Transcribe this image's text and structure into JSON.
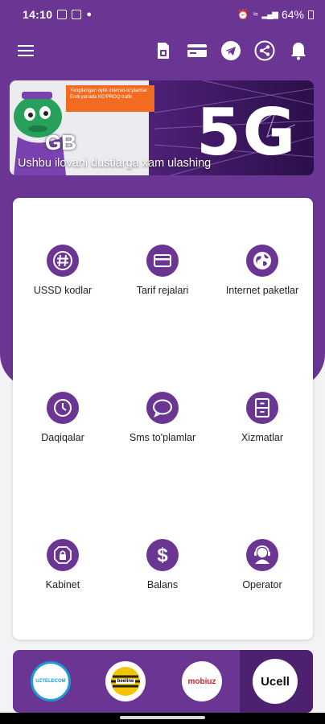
{
  "status_bar": {
    "time": "14:10",
    "battery": "64%"
  },
  "toolbar": {
    "icons": [
      "menu-icon",
      "sim-card-icon",
      "payment-card-icon",
      "telegram-icon",
      "share-icon",
      "bell-icon"
    ]
  },
  "banner": {
    "caption": "Ushbu ilovani dustlarga xam ulashing",
    "promo_text": "Yangilangan oylik internet-to'plamlar Endi yanada KO'PROQ trafik",
    "mascot_text": "GB",
    "big_text": "5G"
  },
  "menu": {
    "items": [
      {
        "label": "USSD kodlar",
        "icon": "hash-icon"
      },
      {
        "label": "Tarif rejalari",
        "icon": "card-icon"
      },
      {
        "label": "Internet paketlar",
        "icon": "globe-icon"
      },
      {
        "label": "Daqiqalar",
        "icon": "clock-icon"
      },
      {
        "label": "Sms to'plamlar",
        "icon": "chat-bubble-icon"
      },
      {
        "label": "Xizmatlar",
        "icon": "cabinet-icon"
      },
      {
        "label": "Kabinet",
        "icon": "shield-icon"
      },
      {
        "label": "Balans",
        "icon": "dollar-icon"
      },
      {
        "label": "Operator",
        "icon": "headset-icon"
      }
    ]
  },
  "operators": [
    {
      "name": "UZTELECOM",
      "color": "#1a9ad6"
    },
    {
      "name": "beeline",
      "color": "#f5c400"
    },
    {
      "name": "mobiuz",
      "color": "#d6202a"
    },
    {
      "name": "Ucell",
      "color": "#111111",
      "selected": true
    }
  ],
  "colors": {
    "primary": "#6a3593",
    "primary_dark": "#4c2170",
    "background": "#f3f2f5",
    "promo_orange": "#f26b21"
  }
}
